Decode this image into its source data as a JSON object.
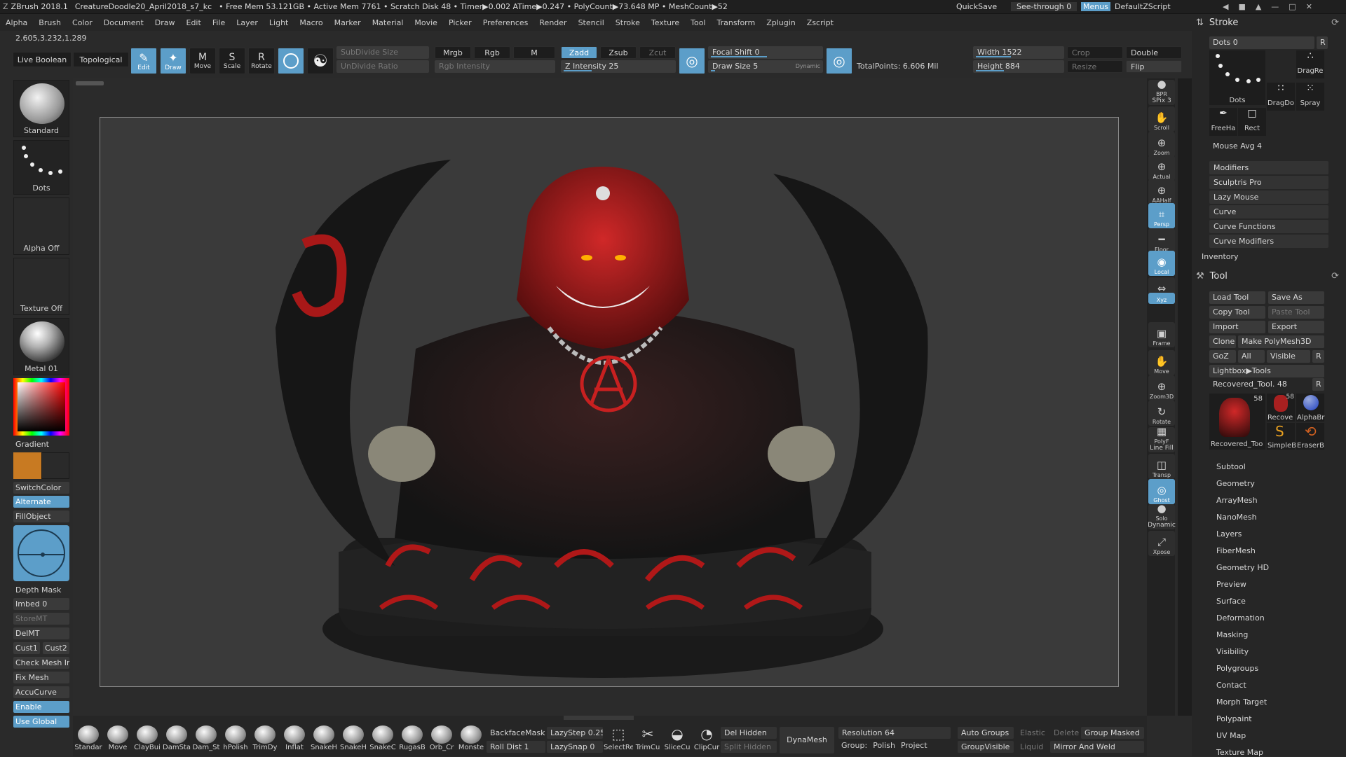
{
  "title_bar": {
    "app": "ZBrush 2018.1",
    "document": "CreatureDoodle20_April2018_s7_kc",
    "stats": "• Free Mem 53.121GB • Active Mem 7761 • Scratch Disk 48 • Timer▶0.002 ATime▶0.247 • PolyCount▶73.648 MP • MeshCount▶52",
    "quicksave": "QuickSave",
    "see_through": "See-through  0",
    "menus": "Menus",
    "script": "DefaultZScript"
  },
  "menu": [
    "Alpha",
    "Brush",
    "Color",
    "Document",
    "Draw",
    "Edit",
    "File",
    "Layer",
    "Light",
    "Macro",
    "Marker",
    "Material",
    "Movie",
    "Picker",
    "Preferences",
    "Render",
    "Stencil",
    "Stroke",
    "Texture",
    "Tool",
    "Transform",
    "Zplugin",
    "Zscript"
  ],
  "coords": "2.605,3.232,1.289",
  "top_shelf": {
    "live_boolean": "Live Boolean",
    "topological": "Topological",
    "edit": "Edit",
    "draw": "Draw",
    "move": "Move",
    "scale": "Scale",
    "rotate": "Rotate",
    "subdivide_size": "SubDivide Size",
    "undivide_ratio": "UnDivide Ratio",
    "mrgb": "Mrgb",
    "rgb": "Rgb",
    "m": "M",
    "rgb_intensity": "Rgb Intensity",
    "zadd": "Zadd",
    "zsub": "Zsub",
    "zcut": "Zcut",
    "z_intensity": "Z Intensity 25",
    "focal_shift": "Focal Shift 0",
    "draw_size": "Draw Size 5",
    "dynamic": "Dynamic",
    "total_points": "TotalPoints:  6.606 Mil",
    "width": "Width 1522",
    "height": "Height 884",
    "crop": "Crop",
    "resize": "Resize",
    "double": "Double",
    "flip": "Flip"
  },
  "left_shelf": {
    "brush": "Standard",
    "stroke": "Dots",
    "alpha": "Alpha Off",
    "texture": "Texture Off",
    "material": "Metal 01",
    "gradient": "Gradient",
    "switch_color": "SwitchColor",
    "alternate": "Alternate",
    "fill_object": "FillObject",
    "depth_mask": "Depth Mask",
    "imbed": "Imbed 0",
    "store_mt": "StoreMT",
    "del_mt": "DelMT",
    "cust1": "Cust1",
    "cust2": "Cust2",
    "check_mesh": "Check Mesh In",
    "fix_mesh": "Fix Mesh",
    "accucurve": "AccuCurve",
    "enable": "Enable",
    "use_global": "Use Global",
    "main_color": "#c87a22",
    "secondary_color": "#2a2a2a"
  },
  "right_shelf": [
    {
      "name": "bpr",
      "label": "BPR",
      "sub": "SPix 3"
    },
    {
      "name": "scroll",
      "label": "Scroll"
    },
    {
      "name": "zoom",
      "label": "Zoom"
    },
    {
      "name": "actual",
      "label": "Actual"
    },
    {
      "name": "aahalf",
      "label": "AAHalf"
    },
    {
      "name": "persp",
      "label": "Persp"
    },
    {
      "name": "floor",
      "label": "Floor"
    },
    {
      "name": "local",
      "label": "Local"
    },
    {
      "name": "lsym",
      "label": "L.Sym"
    },
    {
      "name": "xyz",
      "label": "Xyz"
    },
    {
      "name": "frame",
      "label": "Frame"
    },
    {
      "name": "move",
      "label": "Move"
    },
    {
      "name": "zoom3d",
      "label": "Zoom3D"
    },
    {
      "name": "rotate",
      "label": "Rotate"
    },
    {
      "name": "polyf",
      "label": "PolyF",
      "sub": "Line Fill"
    },
    {
      "name": "transp",
      "label": "Transp"
    },
    {
      "name": "ghost",
      "label": "Ghost"
    },
    {
      "name": "solo",
      "label": "Solo",
      "sub": "Dynamic"
    },
    {
      "name": "xpose",
      "label": "Xpose"
    }
  ],
  "stroke_palette": {
    "title": "Stroke",
    "dots_value": "Dots  0",
    "r": "R",
    "items": [
      "Dots",
      "DragRe",
      "DragDo",
      "Spray",
      "FreeHa",
      "Rect"
    ],
    "mouse_avg": "Mouse Avg 4",
    "subs": [
      "Modifiers",
      "Sculptris Pro",
      "Lazy Mouse",
      "Curve",
      "Curve Functions",
      "Curve Modifiers"
    ],
    "inventory": "Inventory"
  },
  "tool_palette": {
    "title": "Tool",
    "load_tool": "Load Tool",
    "save_as": "Save As",
    "copy_tool": "Copy Tool",
    "paste_tool": "Paste Tool",
    "import": "Import",
    "export": "Export",
    "clone": "Clone",
    "make_polymesh": "Make PolyMesh3D",
    "goz": "GoZ",
    "all": "All",
    "visible": "Visible",
    "r": "R",
    "lightbox_tools": "Lightbox▶Tools",
    "recovered": "Recovered_Tool. 48",
    "thumb_count": "58",
    "thumbs": [
      "Recovered_Too",
      "Recove",
      "AlphaBr",
      "SimpleB",
      "EraserB"
    ],
    "subs": [
      "Subtool",
      "Geometry",
      "ArrayMesh",
      "NanoMesh",
      "Layers",
      "FiberMesh",
      "Geometry HD",
      "Preview",
      "Surface",
      "Deformation",
      "Masking",
      "Visibility",
      "Polygroups",
      "Contact",
      "Morph Target",
      "Polypaint",
      "UV Map",
      "Texture Map"
    ]
  },
  "bottom_shelf": {
    "brushes": [
      "Standar",
      "Move",
      "ClayBui",
      "DamSta",
      "Dam_St",
      "hPolish",
      "TrimDy",
      "Inflat",
      "SnakeH",
      "SnakeH",
      "SnakeC",
      "RugasB",
      "Orb_Cr",
      "Monste"
    ],
    "backface_mask": "BackfaceMask",
    "roll_dist": "Roll Dist 1",
    "lazy_step": "LazyStep 0.25",
    "lazy_snap": "LazySnap 0",
    "select_tools": [
      "SelectRe",
      "TrimCu",
      "SliceCu",
      "ClipCur"
    ],
    "del_hidden": "Del Hidden",
    "split_hidden": "Split Hidden",
    "dynamesh": "DynaMesh",
    "resolution": "Resolution 64",
    "group": "Group:",
    "polish": "Polish",
    "project": "Project",
    "auto_groups": "Auto Groups",
    "group_visible": "GroupVisible",
    "elastic": "Elastic",
    "liquid": "Liquid",
    "delete": "Delete",
    "group_masked": "Group Masked",
    "mirror_and_weld": "Mirror And Weld"
  },
  "colors": {
    "accent": "#5c9ec9",
    "panel": "#262626",
    "canvas": "#3a3a3a"
  }
}
